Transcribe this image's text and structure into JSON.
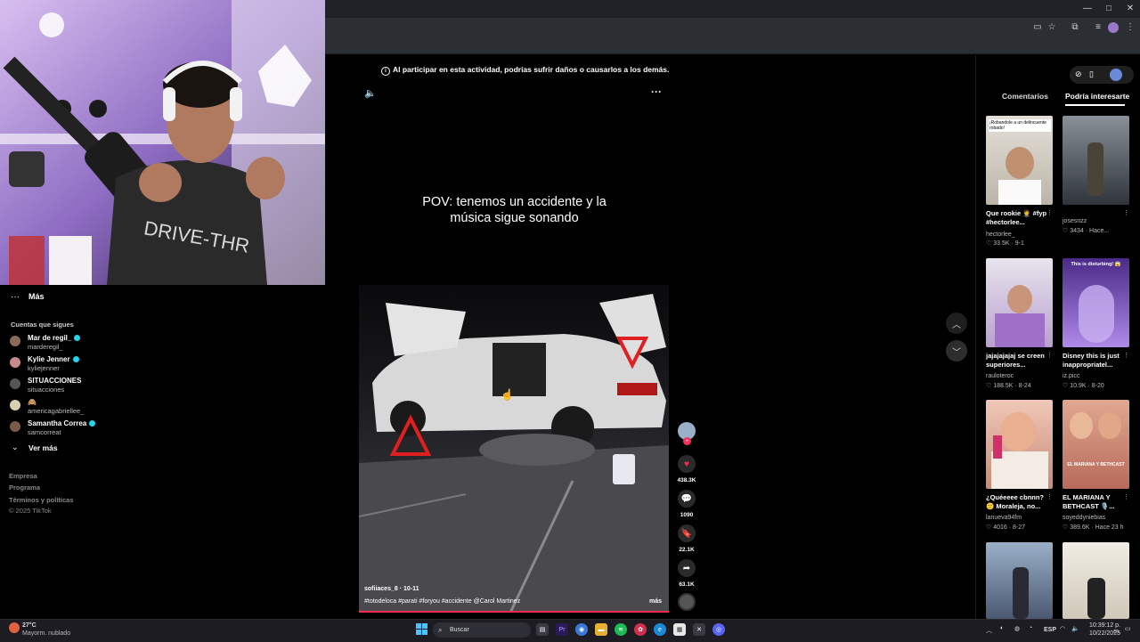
{
  "warning": "Al participar en esta actividad, podrías sufrir daños o causarlos a los demás.",
  "video": {
    "caption": "POV: tenemos un accidente y la música sigue sonando",
    "author": "sofiiaces_8 · 10-11",
    "hashtags": "#totodeloca  #parati  #foryou  #accidente  @Carol Martinez",
    "more": "más",
    "likes": "438.3K",
    "comments": "1090",
    "saves": "22.1K",
    "shares": "63.1K"
  },
  "sidebar": {
    "more_label": "Más",
    "following_header": "Cuentas que sigues",
    "accounts": [
      {
        "name": "Mar de regil_",
        "handle": "marderegil_",
        "verified": true,
        "color": "#8a6a5a"
      },
      {
        "name": "Kylie Jenner",
        "handle": "kyliejenner",
        "verified": true,
        "color": "#c98a8a"
      },
      {
        "name": "SITUACCIONES",
        "handle": "situacciones",
        "verified": false,
        "color": "#555555"
      },
      {
        "name": "🙈",
        "handle": "americagabriellee_",
        "verified": false,
        "color": "#d8d0b0"
      },
      {
        "name": "Samantha Correa",
        "handle": "samcorreat",
        "verified": true,
        "color": "#7a5a4a"
      }
    ],
    "see_more": "Ver más",
    "footer": [
      "Empresa",
      "Programa",
      "Términos y políticas",
      "© 2025 TikTok"
    ]
  },
  "rightpanel": {
    "tabs": [
      "Comentarios",
      "Podría interesarte"
    ],
    "items": [
      {
        "title": "Que rookie 🤵 #fyp #hectorlee...",
        "author": "hectorlee_",
        "meta": "♡ 33.5K · 9-1",
        "overlay": "¡Robandole a un delincuente robado!",
        "bg": "#d9d4cc"
      },
      {
        "title": "",
        "author": "josesnzz",
        "meta": "♡ 3434 · Hace...",
        "overlay": "",
        "bg": "#3a4048"
      },
      {
        "title": "jajajajajaj se creen superiores...",
        "author": "rauloteroc",
        "meta": "♡ 188.5K · 8-24",
        "overlay": "",
        "bg": "#c7b8d8"
      },
      {
        "title": "Disney this is just inappropriatel...",
        "author": "iz.picc",
        "meta": "♡ 10.9K · 8-20",
        "overlay": "This is disturbing! 😱",
        "bg": "#6a4aa8"
      },
      {
        "title": "¿Quéeeee cbnnn? 🙂 Moraleja, no...",
        "author": "lanueva94fm",
        "meta": "♡ 4016 · 8-27",
        "overlay": "",
        "bg": "#d8a088"
      },
      {
        "title": "EL MARIANA Y BETHCAST 🎙️...",
        "author": "soyeddyniebias",
        "meta": "♡ 389.6K · Hace 23 h",
        "overlay": "EL MARIANA Y BETHCAST",
        "bg": "#c88a78"
      },
      {
        "title": "",
        "author": "",
        "meta": "",
        "overlay": "",
        "bg": "#6a7890"
      },
      {
        "title": "",
        "author": "",
        "meta": "",
        "overlay": "",
        "bg": "#d8d0c0"
      }
    ]
  },
  "taskbar": {
    "weather_temp": "27°C",
    "weather_desc": "Mayorm. nublado",
    "search": "Buscar",
    "lang": "ESP",
    "time": "10:39:12 p. m.",
    "date": "10/22/2025"
  },
  "colors": {
    "accent": "#fe2c55",
    "verified": "#20d5ec"
  }
}
